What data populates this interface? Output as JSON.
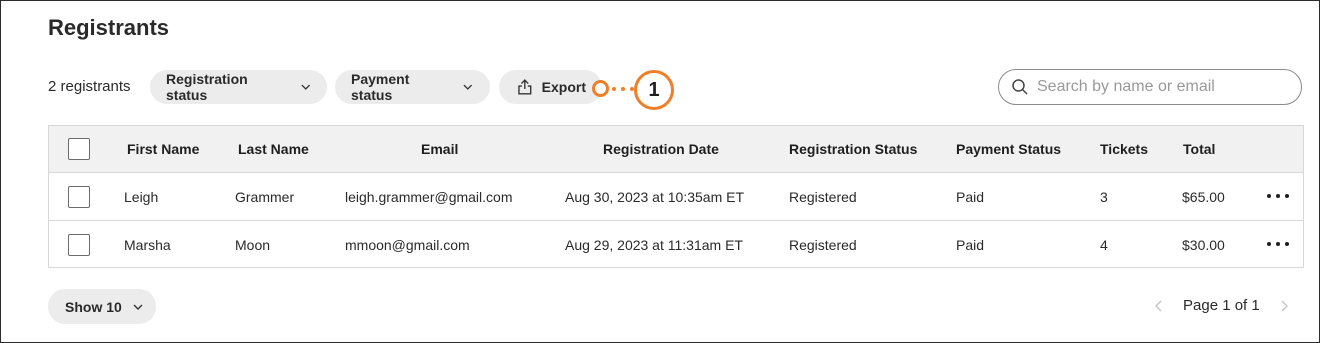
{
  "page": {
    "title": "Registrants",
    "count_label": "2 registrants"
  },
  "toolbar": {
    "registration_status_label": "Registration status",
    "payment_status_label": "Payment status",
    "export_label": "Export",
    "callout_number": "1",
    "callout_color": "#f07f2a"
  },
  "search": {
    "placeholder": "Search by name or email",
    "value": ""
  },
  "table": {
    "headers": [
      "First Name",
      "Last Name",
      "Email",
      "Registration Date",
      "Registration Status",
      "Payment Status",
      "Tickets",
      "Total"
    ],
    "rows": [
      [
        "Leigh",
        "Grammer",
        "leigh.grammer@gmail.com",
        "Aug 30, 2023 at 10:35am ET",
        "Registered",
        "Paid",
        "3",
        "$65.00"
      ],
      [
        "Marsha",
        "Moon",
        "mmoon@gmail.com",
        "Aug 29, 2023 at 11:31am ET",
        "Registered",
        "Paid",
        "4",
        "$30.00"
      ]
    ]
  },
  "footer": {
    "show_label": "Show 10",
    "page_label": "Page 1 of 1"
  },
  "icons": {
    "chevron": "chevron-down-icon",
    "export": "upload-icon",
    "search": "search-icon",
    "more": "more-horizontal-icon",
    "prev": "chevron-left-icon",
    "next": "chevron-right-icon"
  }
}
